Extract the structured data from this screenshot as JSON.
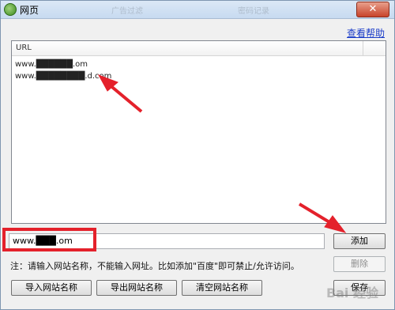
{
  "window": {
    "title": "网页",
    "bg_tabs": [
      "广告过滤",
      "密码记录"
    ]
  },
  "help_link": "查看帮助",
  "list": {
    "header": "URL",
    "rows": [
      "www.██████.om",
      "www.████████.d.com"
    ]
  },
  "input": {
    "value": "www.███.om"
  },
  "buttons": {
    "add": "添加",
    "delete": "删除",
    "import": "导入网站名称",
    "export": "导出网站名称",
    "clear": "清空网站名称",
    "save": "保存"
  },
  "note": "注：请输入网站名称，不能输入网址。比如添加\"百度\"即可禁止/允许访问。",
  "watermark": "Bai 经验",
  "colors": {
    "accent_red": "#e4212b",
    "link": "#1a3cc8"
  }
}
